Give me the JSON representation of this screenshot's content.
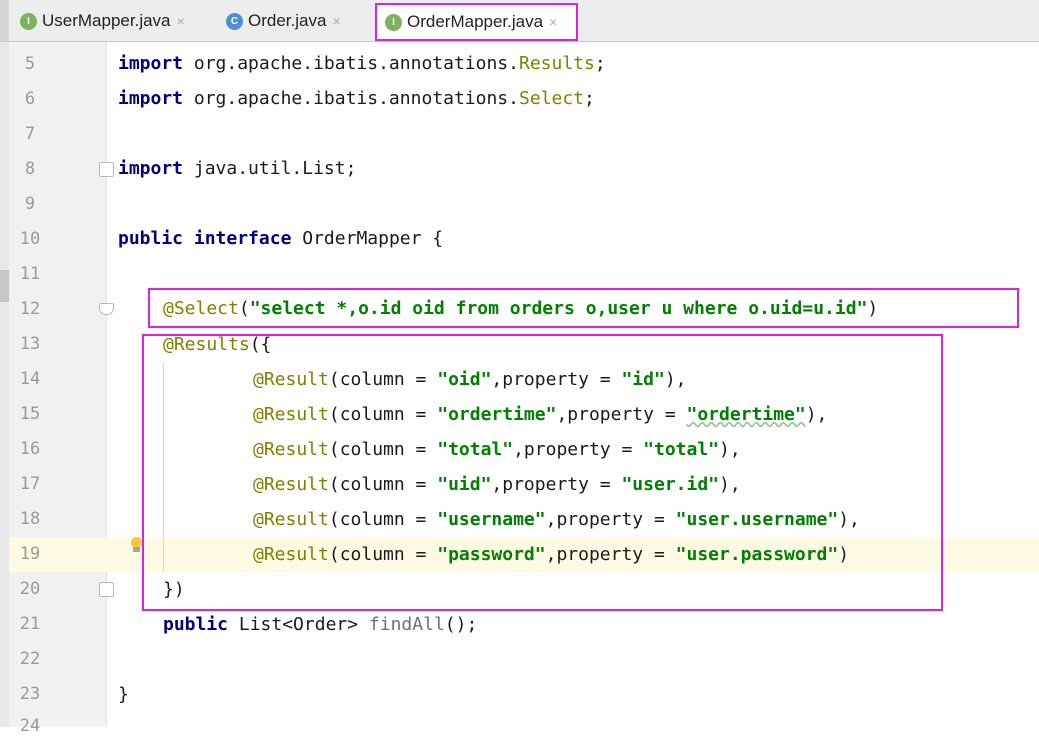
{
  "tabs": [
    {
      "label": "UserMapper.java",
      "icon": "interface-icon",
      "icon_letter": "I",
      "close": "×"
    },
    {
      "label": "Order.java",
      "icon": "class-icon",
      "icon_letter": "C",
      "close": "×"
    },
    {
      "label": "OrderMapper.java",
      "icon": "interface-icon",
      "icon_letter": "I",
      "close": "×",
      "active": true
    }
  ],
  "colors": {
    "keyword": "#000080",
    "string": "#008000",
    "annotation": "#808000",
    "highlight_box": "#e020e0",
    "current_line": "#fffae3"
  },
  "editor": {
    "line_numbers": [
      "5",
      "6",
      "7",
      "8",
      "9",
      "10",
      "11",
      "12",
      "13",
      "14",
      "15",
      "16",
      "17",
      "18",
      "19",
      "20",
      "21",
      "22",
      "23",
      "24"
    ],
    "current_line": "19",
    "lines": {
      "l5": {
        "kw": "import",
        "pkg": " org.apache.ibatis.annotations.",
        "cls": "Results",
        "end": ";"
      },
      "l6": {
        "kw": "import",
        "pkg": " org.apache.ibatis.annotations.",
        "cls": "Select",
        "end": ";"
      },
      "l8": {
        "kw": "import",
        "rest": " java.util.List;"
      },
      "l10": {
        "kw1": "public",
        "kw2": "interface",
        "rest": " OrderMapper {"
      },
      "l12": {
        "ann": "@Select",
        "open": "(",
        "str": "\"select *,o.id oid from orders o,user u where o.uid=u.id\"",
        "close": ")"
      },
      "l13": {
        "ann": "@Results",
        "rest": "({"
      },
      "l14": {
        "ann": "@Result",
        "a": "(column = ",
        "s1": "\"oid\"",
        "b": ",property = ",
        "s2": "\"id\"",
        "c": "),"
      },
      "l15": {
        "ann": "@Result",
        "a": "(column = ",
        "s1": "\"ordertime\"",
        "b": ",property = ",
        "s2": "\"ordertime\"",
        "c": "),"
      },
      "l16": {
        "ann": "@Result",
        "a": "(column = ",
        "s1": "\"total\"",
        "b": ",property = ",
        "s2": "\"total\"",
        "c": "),"
      },
      "l17": {
        "ann": "@Result",
        "a": "(column = ",
        "s1": "\"uid\"",
        "b": ",property = ",
        "s2": "\"user.id\"",
        "c": "),"
      },
      "l18": {
        "ann": "@Result",
        "a": "(column = ",
        "s1": "\"username\"",
        "b": ",property = ",
        "s2": "\"user.username\"",
        "c": "),"
      },
      "l19": {
        "ann": "@Result",
        "a": "(column = ",
        "s1": "\"password\"",
        "b": ",property = ",
        "s2": "\"user.password\"",
        "c": ")"
      },
      "l20": {
        "rest": "})"
      },
      "l21": {
        "kw": "public",
        "type": " List<Order> ",
        "method": "findAll",
        "end": "();"
      },
      "l23": {
        "rest": "}"
      }
    }
  }
}
